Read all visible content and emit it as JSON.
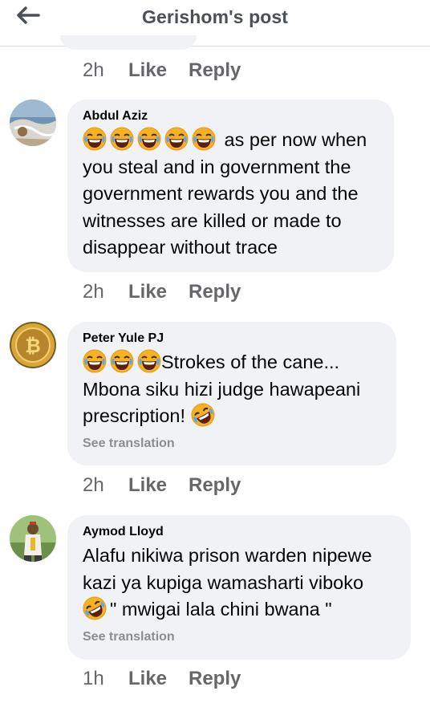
{
  "header": {
    "title": "Gerishom's post",
    "back_icon": "back-arrow-icon"
  },
  "colors": {
    "bubble": "#f0f2f5",
    "meta": "#65676b",
    "name": "#050505"
  },
  "prev_comment": {
    "time": "2h",
    "like": "Like",
    "reply": "Reply"
  },
  "comments": [
    {
      "author": "Abdul Aziz",
      "text": "as per now when you steal and in government the government rewards you and the witnesses are killed or made to disappear without trace",
      "time": "2h",
      "like": "Like",
      "reply": "Reply"
    },
    {
      "author": "Peter Yule PJ",
      "text_a": "Strokes of the cane...",
      "text_b": "Mbona siku hizi judge hawapeani prescription!",
      "see_translation": "See translation",
      "time": "2h",
      "like": "Like",
      "reply": "Reply"
    },
    {
      "author": "Aymod Lloyd",
      "text_a": "Alafu nikiwa prison warden nipewe kazi ya kupiga wamasharti viboko",
      "text_b": "\" mwigai  lala chini bwana \"",
      "see_translation": "See translation",
      "time": "1h",
      "like": "Like",
      "reply": "Reply"
    }
  ]
}
